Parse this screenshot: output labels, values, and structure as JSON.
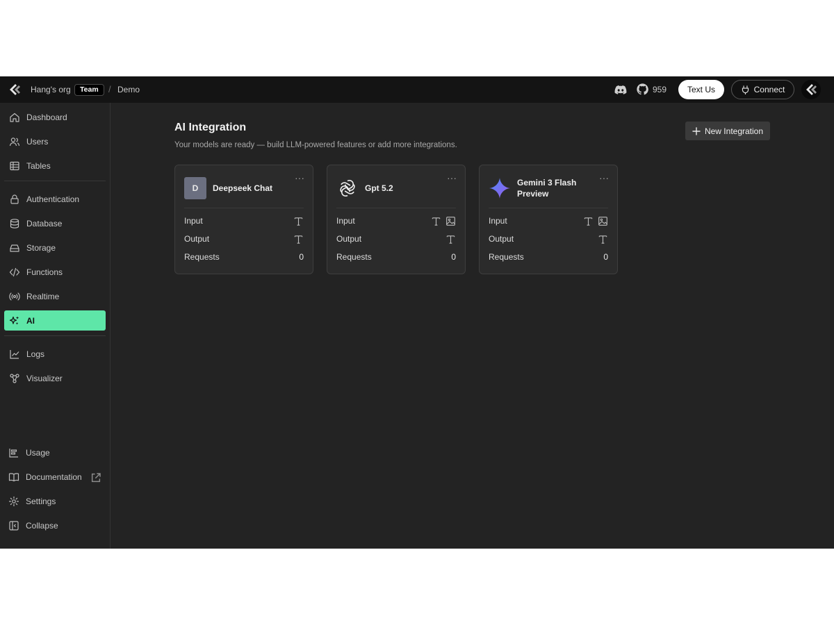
{
  "topbar": {
    "org": "Hang's org",
    "team_badge": "Team",
    "separator": "/",
    "project": "Demo",
    "github_stars": "959",
    "text_us": "Text Us",
    "connect": "Connect"
  },
  "sidebar": {
    "items": [
      {
        "label": "Dashboard",
        "icon": "home-icon"
      },
      {
        "label": "Users",
        "icon": "users-icon"
      },
      {
        "label": "Tables",
        "icon": "table-icon"
      },
      {
        "label": "Authentication",
        "icon": "lock-icon"
      },
      {
        "label": "Database",
        "icon": "database-icon"
      },
      {
        "label": "Storage",
        "icon": "storage-icon"
      },
      {
        "label": "Functions",
        "icon": "code-icon"
      },
      {
        "label": "Realtime",
        "icon": "broadcast-icon"
      },
      {
        "label": "AI",
        "icon": "sparkles-icon",
        "active": true
      },
      {
        "label": "Logs",
        "icon": "chart-line-icon"
      },
      {
        "label": "Visualizer",
        "icon": "graph-icon"
      }
    ],
    "footer": [
      {
        "label": "Usage",
        "icon": "usage-icon"
      },
      {
        "label": "Documentation",
        "icon": "book-icon"
      },
      {
        "label": "Settings",
        "icon": "gear-icon"
      },
      {
        "label": "Collapse",
        "icon": "collapse-icon"
      }
    ]
  },
  "main": {
    "title": "AI Integration",
    "subtitle": "Your models are ready — build LLM-powered features or add more integrations.",
    "new_button": "New Integration",
    "more": "···",
    "labels": {
      "input": "Input",
      "output": "Output",
      "requests": "Requests"
    },
    "cards": [
      {
        "name": "Deepseek Chat",
        "letter": "D",
        "icon": "deepseek-letter-avatar",
        "input_modes": [
          "text"
        ],
        "output_modes": [
          "text"
        ],
        "requests": "0"
      },
      {
        "name": "Gpt 5.2",
        "icon": "openai-icon",
        "input_modes": [
          "text",
          "image"
        ],
        "output_modes": [
          "text"
        ],
        "requests": "0"
      },
      {
        "name": "Gemini 3 Flash Preview",
        "icon": "gemini-icon",
        "input_modes": [
          "text",
          "image"
        ],
        "output_modes": [
          "text"
        ],
        "requests": "0"
      }
    ]
  },
  "colors": {
    "accent": "#5ee6a8",
    "background": "#232323",
    "topbar": "#141414",
    "card": "#2b2b2b"
  }
}
